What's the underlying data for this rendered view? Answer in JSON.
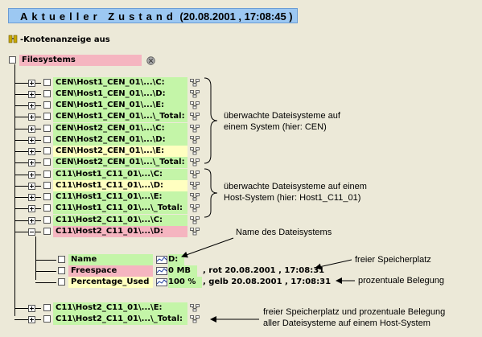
{
  "header": {
    "title_prefix": "Aktueller Zustand",
    "title_time": "(20.08.2001 , 17:08:45 )"
  },
  "toggle": {
    "label": "-Knotenanzeige aus"
  },
  "root": {
    "label": "Filesystems"
  },
  "nodes": [
    {
      "label": "CEN\\Host1_CEN_01\\...\\C:",
      "color": "green"
    },
    {
      "label": "CEN\\Host1_CEN_01\\...\\D:",
      "color": "green"
    },
    {
      "label": "CEN\\Host1_CEN_01\\...\\E:",
      "color": "green"
    },
    {
      "label": "CEN\\Host1_CEN_01\\...\\_Total:",
      "color": "green"
    },
    {
      "label": "CEN\\Host2_CEN_01\\...\\C:",
      "color": "green"
    },
    {
      "label": "CEN\\Host2_CEN_01\\...\\D:",
      "color": "green"
    },
    {
      "label": "CEN\\Host2_CEN_01\\...\\E:",
      "color": "yellow"
    },
    {
      "label": "CEN\\Host2_CEN_01\\...\\_Total:",
      "color": "green"
    },
    {
      "label": "C11\\Host1_C11_01\\...\\C:",
      "color": "green"
    },
    {
      "label": "C11\\Host1_C11_01\\...\\D:",
      "color": "yellow"
    },
    {
      "label": "C11\\Host1_C11_01\\...\\E:",
      "color": "green"
    },
    {
      "label": "C11\\Host1_C11_01\\...\\_Total:",
      "color": "green"
    },
    {
      "label": "C11\\Host2_C11_01\\...\\C:",
      "color": "green"
    },
    {
      "label": "C11\\Host2_C11_01\\...\\D:",
      "color": "pink"
    }
  ],
  "children": [
    {
      "label": "Name",
      "color": "green",
      "value": "D:",
      "value_color": "green",
      "status": ""
    },
    {
      "label": "Freespace",
      "color": "pink",
      "value": "0 MB",
      "value_color": "green",
      "status": ", rot 20.08.2001 , 17:08:31"
    },
    {
      "label": "Percentage_Used",
      "color": "yellow",
      "value": "100 %",
      "value_color": "green",
      "status": ", gelb 20.08.2001 , 17:08:31"
    }
  ],
  "bottom_nodes": [
    {
      "label": "C11\\Host2_C11_01\\...\\E:",
      "color": "green"
    },
    {
      "label": "C11\\Host2_C11_01\\...\\_Total:",
      "color": "green"
    }
  ],
  "annotations": {
    "a1_line1": "überwachte Dateisysteme auf",
    "a1_line2": "einem System (hier: CEN)",
    "a2_line1": "überwachte Dateisysteme auf einem",
    "a2_line2": "Host-System (hier: Host1_C11_01)",
    "a3": "Name des Dateisystems",
    "a4": "freier Speicherplatz",
    "a5": "prozentuale Belegung",
    "a6_line1": "freier Speicherplatz und prozentuale Belegung",
    "a6_line2": "aller Dateisysteme auf einem Host-System"
  },
  "colors": {
    "green": "#C4F5A8",
    "yellow": "#FFFFC0",
    "pink": "#F5B5C0",
    "title_bg": "#9CC8F2",
    "background": "#ECE9D8"
  }
}
